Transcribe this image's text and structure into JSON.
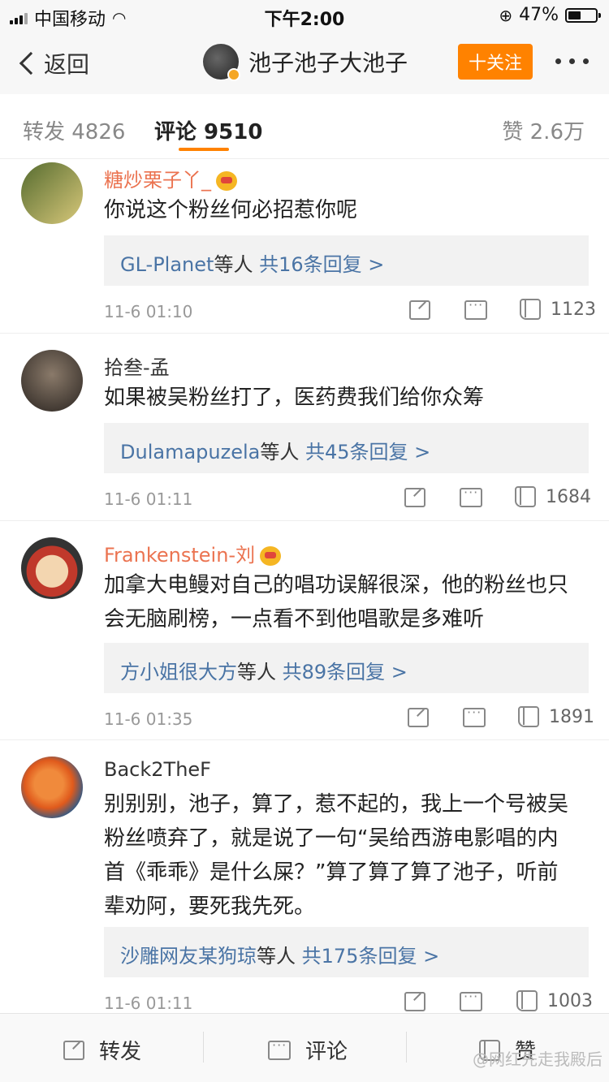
{
  "status_bar": {
    "carrier": "中国移动",
    "time": "下午2:00",
    "battery_pct": "47%",
    "battery_level": 0.47
  },
  "nav": {
    "back_label": "返回",
    "title": "池子池子大池子",
    "follow_label": "十关注"
  },
  "tabs": {
    "repost": "转发 4826",
    "comments": "评论 9510",
    "likes": "赞 2.6万"
  },
  "comments": [
    {
      "username": "糖炒栗子丫_",
      "vip": true,
      "text": "你说这个粉丝何必招惹你呢",
      "reply_who": "GL-Planet",
      "reply_etc": "等人",
      "reply_count": "共16条回复 >",
      "time": "11-6 01:10",
      "likes": "1123",
      "avatar_color": "#556b2f"
    },
    {
      "username": "拾叁-孟",
      "vip": false,
      "text": "如果被吴粉丝打了，医药费我们给你众筹",
      "reply_who": "Dulamapuzela",
      "reply_etc": "等人",
      "reply_count": "共45条回复 >",
      "time": "11-6 01:11",
      "likes": "1684",
      "avatar_color": "#3a2f2a"
    },
    {
      "username": "Frankenstein-刘",
      "vip": true,
      "text_lines": [
        "加拿大电鳗对自己的唱功误解很深，他的粉丝也只",
        "会无脑刷榜，一点看不到他唱歌是多难听"
      ],
      "reply_who": "方小姐很大方",
      "reply_etc": "等人",
      "reply_count": "共89条回复 >",
      "time": "11-6 01:35",
      "likes": "1891",
      "avatar_color": "#c0392b"
    },
    {
      "username": "Back2TheF",
      "vip": false,
      "text_lines": [
        "别别别，池子，算了，惹不起的，我上一个号被吴",
        "粉丝喷弃了，就是说了一句“吴给西游电影唱的内",
        "首《乖乖》是什么屎？”算了算了算了池子，听前",
        "辈劝阿，要死我先死。"
      ],
      "reply_who": "沙雕网友某狗琼",
      "reply_etc": "等人",
      "reply_count": "共175条回复 >",
      "time": "11-6 01:11",
      "likes": "1003",
      "avatar_color": "#e05a1c"
    }
  ],
  "bottom_bar": {
    "repost": "转发",
    "comment": "评论",
    "like": "赞",
    "watermark": "@网红先走我殿后"
  },
  "colors": {
    "accent": "#ff8200",
    "link": "#4a74a5",
    "vip_name": "#eb7350"
  }
}
